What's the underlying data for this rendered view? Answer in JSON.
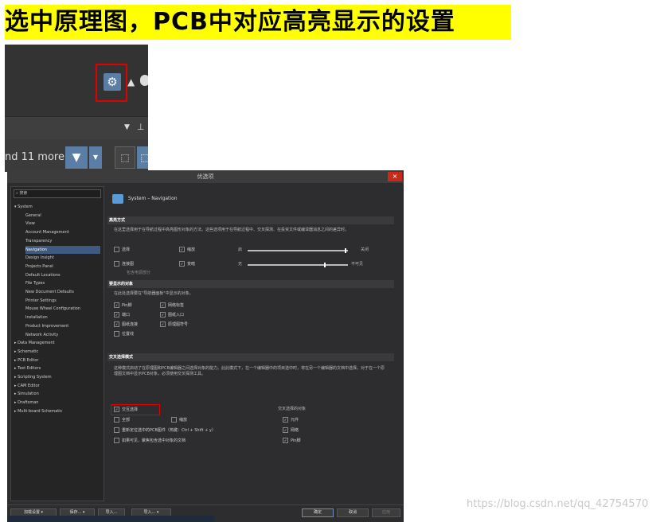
{
  "banner": {
    "title": "选中原理图，PCB中对应高亮显示的设置"
  },
  "toolbar": {
    "gear_icon": "gear-icon",
    "filter_summary": "nd 11 more)",
    "filter_icon": "filter-icon"
  },
  "dialog": {
    "title": "优选项",
    "close": "×",
    "search_placeholder": "搜索",
    "tree": [
      {
        "label": "System",
        "level": 0,
        "expanded": true
      },
      {
        "label": "General",
        "level": 1
      },
      {
        "label": "View",
        "level": 1
      },
      {
        "label": "Account Management",
        "level": 1
      },
      {
        "label": "Transparency",
        "level": 1
      },
      {
        "label": "Navigation",
        "level": 1,
        "selected": true
      },
      {
        "label": "Design Insight",
        "level": 1
      },
      {
        "label": "Projects Panel",
        "level": 1
      },
      {
        "label": "Default Locations",
        "level": 1
      },
      {
        "label": "File Types",
        "level": 1
      },
      {
        "label": "New Document Defaults",
        "level": 1
      },
      {
        "label": "Printer Settings",
        "level": 1
      },
      {
        "label": "Mouse Wheel Configuration",
        "level": 1
      },
      {
        "label": "Installation",
        "level": 1
      },
      {
        "label": "Product Improvement",
        "level": 1
      },
      {
        "label": "Network Activity",
        "level": 1
      },
      {
        "label": "Data Management",
        "level": 0
      },
      {
        "label": "Schematic",
        "level": 0
      },
      {
        "label": "PCB Editor",
        "level": 0
      },
      {
        "label": "Text Editors",
        "level": 0
      },
      {
        "label": "Scripting System",
        "level": 0
      },
      {
        "label": "CAM Editor",
        "level": 0
      },
      {
        "label": "Simulation",
        "level": 0
      },
      {
        "label": "Draftsman",
        "level": 0
      },
      {
        "label": "Multi-board Schematic",
        "level": 0
      }
    ],
    "page_title": "System – Navigation",
    "sections": {
      "highlight": {
        "header": "高亮方式",
        "desc": "在这里选择用于在导航过程中高亮图形对象的方法。这些选项用于在导航过程中、交叉探测、在投资文件或编译器消息之间的差异时。",
        "opt_select": "选择",
        "opt_zoom": "缩放",
        "label_open": "启",
        "label_close": "关闭",
        "opt_conn": "连接图",
        "opt_mask": "变暗",
        "label_none": "无",
        "label_invisible": "不可见",
        "opt_include": "包含电源部分"
      },
      "objects": {
        "header": "要显示的对象",
        "desc": "在此处选择要在\"导航器面板\"中显示的对象。",
        "items": [
          "Pin脚",
          "网络标签",
          "端口",
          "图纸入口",
          "图纸连接",
          "原理图符号",
          "位置线"
        ]
      },
      "cross": {
        "header": "交叉选择模式",
        "desc": "这种模式启动了在原理图和PCB编辑器之间选择对象的能力。此此模式下，在一个编辑器中的项目选中时，将在另一个编辑器的文档中选择。对于在一个原理图文档中显示PCB对象，必须使用交叉探测工具。",
        "opt_cross": "交互选择",
        "opt_all": "全部",
        "opt_zoom": "缩放",
        "opt_reposition": "重新定位选中的PCB图件（热键：Ctrl + Shift + y）",
        "opt_visible": "如果可见，聚焦包含选中对象的文档",
        "target_header": "交叉选择的对象",
        "targets": [
          "元件",
          "网络",
          "Pin脚"
        ]
      }
    },
    "buttons": {
      "save": "加载设置",
      "export": "保存...",
      "import": "导入...",
      "import2": "导入...",
      "ok": "确定",
      "cancel": "取消",
      "apply": "应用"
    }
  },
  "watermark": "https://blog.csdn.net/qq_42754570"
}
